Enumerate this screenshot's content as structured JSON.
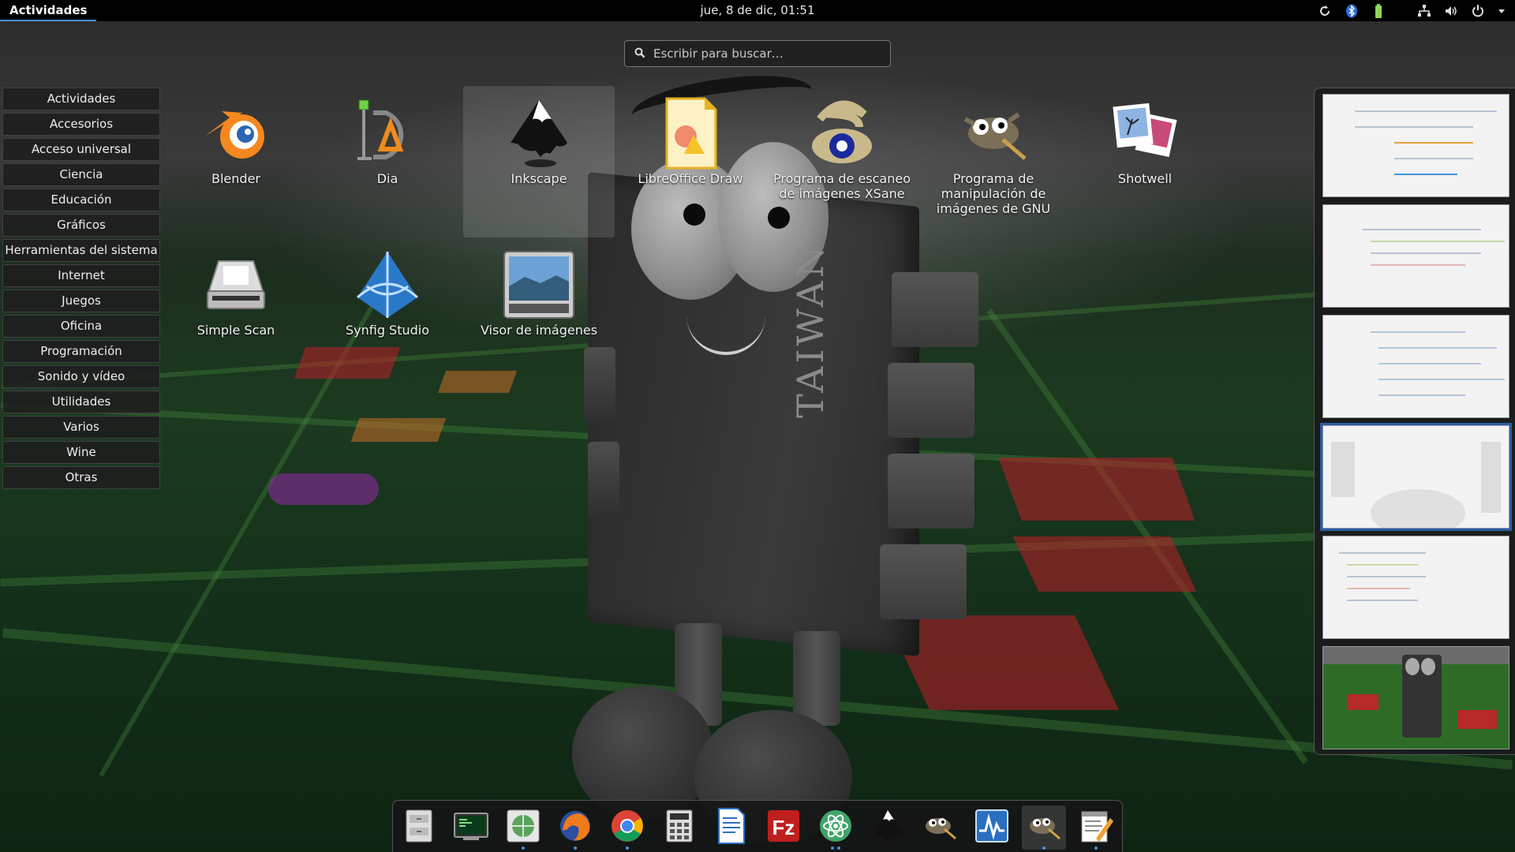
{
  "topbar": {
    "activities_label": "Actividades",
    "clock": "jue,  8 de dic, 01:51",
    "status_icons": [
      "refresh-icon",
      "bluetooth-icon",
      "battery-icon",
      "network-icon",
      "volume-icon",
      "power-icon",
      "chevron-down-icon"
    ]
  },
  "search": {
    "placeholder": "Escribir para buscar…"
  },
  "categories": [
    "Actividades",
    "Accesorios",
    "Acceso universal",
    "Ciencia",
    "Educación",
    "Gráficos",
    "Herramientas del sistema",
    "Internet",
    "Juegos",
    "Oficina",
    "Programación",
    "Sonido y vídeo",
    "Utilidades",
    "Varios",
    "Wine",
    "Otras"
  ],
  "apps": [
    {
      "label": "Blender",
      "icon": "blender-icon"
    },
    {
      "label": "Dia",
      "icon": "dia-icon"
    },
    {
      "label": "Inkscape",
      "icon": "inkscape-icon",
      "selected": true
    },
    {
      "label": "LibreOffice Draw",
      "icon": "libreoffice-draw-icon"
    },
    {
      "label": "Programa de escaneo de imágenes XSane",
      "icon": "xsane-icon"
    },
    {
      "label": "Programa de manipulación de imágenes de GNU",
      "icon": "gimp-icon"
    },
    {
      "label": "Shotwell",
      "icon": "shotwell-icon"
    },
    {
      "label": "Simple Scan",
      "icon": "simple-scan-icon"
    },
    {
      "label": "Synfig Studio",
      "icon": "synfig-icon"
    },
    {
      "label": "Visor de imágenes",
      "icon": "image-viewer-icon"
    }
  ],
  "workspaces": {
    "count": 6,
    "active_index": 3
  },
  "dock": [
    {
      "icon": "file-manager-icon",
      "running": false
    },
    {
      "icon": "terminal-icon",
      "running": false
    },
    {
      "icon": "network-globe-icon",
      "running": true
    },
    {
      "icon": "firefox-icon",
      "running": true
    },
    {
      "icon": "chrome-icon",
      "running": true
    },
    {
      "icon": "calculator-icon",
      "running": false
    },
    {
      "icon": "writer-icon",
      "running": false
    },
    {
      "icon": "filezilla-icon",
      "running": false
    },
    {
      "icon": "atom-icon",
      "running": true
    },
    {
      "icon": "inkscape-icon",
      "running": false
    },
    {
      "icon": "gimp-icon",
      "running": false
    },
    {
      "icon": "monitor-icon",
      "running": false
    },
    {
      "icon": "gimp-icon",
      "running": true,
      "selected": true
    },
    {
      "icon": "text-editor-icon",
      "running": true
    }
  ],
  "wallpaper": {
    "mascot_text": "TAIWAN"
  },
  "colors": {
    "accent": "#4a90d9",
    "topbar": "#000000",
    "panel": "#1e1e1e"
  }
}
